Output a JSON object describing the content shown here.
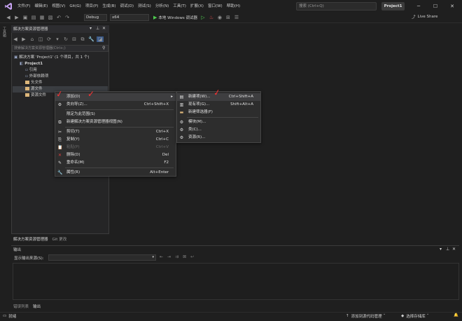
{
  "menu": [
    "文件(F)",
    "编辑(E)",
    "视图(V)",
    "Git(G)",
    "项目(P)",
    "生成(B)",
    "调试(D)",
    "测试(S)",
    "分析(N)",
    "工具(T)",
    "扩展(X)",
    "窗口(W)",
    "帮助(H)"
  ],
  "search_placeholder": "搜索 (Ctrl+Q)",
  "project_badge": "Project1",
  "window_buttons": {
    "minimize": "─",
    "maximize": "☐",
    "close": "✕"
  },
  "toolbar": {
    "config": "Debug",
    "platform": "x64",
    "run_label": "本地 Windows 调试器",
    "live_share": "Live Share"
  },
  "left_strip_label": "工具箱",
  "solution_explorer": {
    "title": "解决方案资源管理器",
    "search_placeholder": "搜索解决方案资源管理器(Ctrl+;)",
    "tree": [
      {
        "label": "解决方案 'Project1' (1 个项目，共 1 个)",
        "indent": 0,
        "icon": "solution"
      },
      {
        "label": "Project1",
        "indent": 1,
        "icon": "project",
        "bold": true
      },
      {
        "label": "引用",
        "indent": 2,
        "icon": "references"
      },
      {
        "label": "外部依赖项",
        "indent": 2,
        "icon": "external"
      },
      {
        "label": "头文件",
        "indent": 2,
        "icon": "folder"
      },
      {
        "label": "源文件",
        "indent": 2,
        "icon": "folder",
        "selected": true
      },
      {
        "label": "资源文件",
        "indent": 2,
        "icon": "folder"
      }
    ],
    "bottom_tabs": [
      "解决方案资源管理器",
      "Git 更改"
    ]
  },
  "output": {
    "title": "输出",
    "source_label": "显示输出来源(S):",
    "tabs": [
      "错误列表",
      "输出"
    ]
  },
  "status": {
    "ready": "就绪",
    "add_source": "添加到源代码管理",
    "select_repo": "选择存储库"
  },
  "context_menu": [
    {
      "label": "添加(D)",
      "shortcut": "",
      "submenu": true,
      "icon": "",
      "hl": true
    },
    {
      "label": "类向导(Z)...",
      "shortcut": "Ctrl+Shift+X",
      "icon": "wizard"
    },
    {
      "sep": true
    },
    {
      "label": "限定为此范围(S)",
      "shortcut": "",
      "icon": ""
    },
    {
      "label": "新建解决方案资源管理器视图(N)",
      "shortcut": "",
      "icon": "new-view"
    },
    {
      "sep": true
    },
    {
      "label": "剪切(T)",
      "shortcut": "Ctrl+X",
      "icon": "cut"
    },
    {
      "label": "复制(Y)",
      "shortcut": "Ctrl+C",
      "icon": "copy"
    },
    {
      "label": "粘贴(P)",
      "shortcut": "Ctrl+V",
      "icon": "paste",
      "disabled": true
    },
    {
      "label": "删除(D)",
      "shortcut": "Del",
      "icon": "delete"
    },
    {
      "label": "重命名(M)",
      "shortcut": "F2",
      "icon": "rename"
    },
    {
      "sep": true
    },
    {
      "label": "属性(R)",
      "shortcut": "Alt+Enter",
      "icon": "properties"
    }
  ],
  "submenu": [
    {
      "label": "新建项(W)...",
      "shortcut": "Ctrl+Shift+A",
      "icon": "new-item",
      "hl": true
    },
    {
      "label": "现有项(G)...",
      "shortcut": "Shift+Alt+A",
      "icon": "existing-item"
    },
    {
      "label": "新建筛选器(F)",
      "shortcut": "",
      "icon": "filter"
    },
    {
      "sep": true
    },
    {
      "label": "模块(M)...",
      "shortcut": "",
      "icon": "module"
    },
    {
      "label": "类(C)...",
      "shortcut": "",
      "icon": "class"
    },
    {
      "label": "资源(R)...",
      "shortcut": "",
      "icon": "resource"
    }
  ],
  "colors": {
    "accent": "#68217a",
    "check_marks": "#ff3333"
  }
}
